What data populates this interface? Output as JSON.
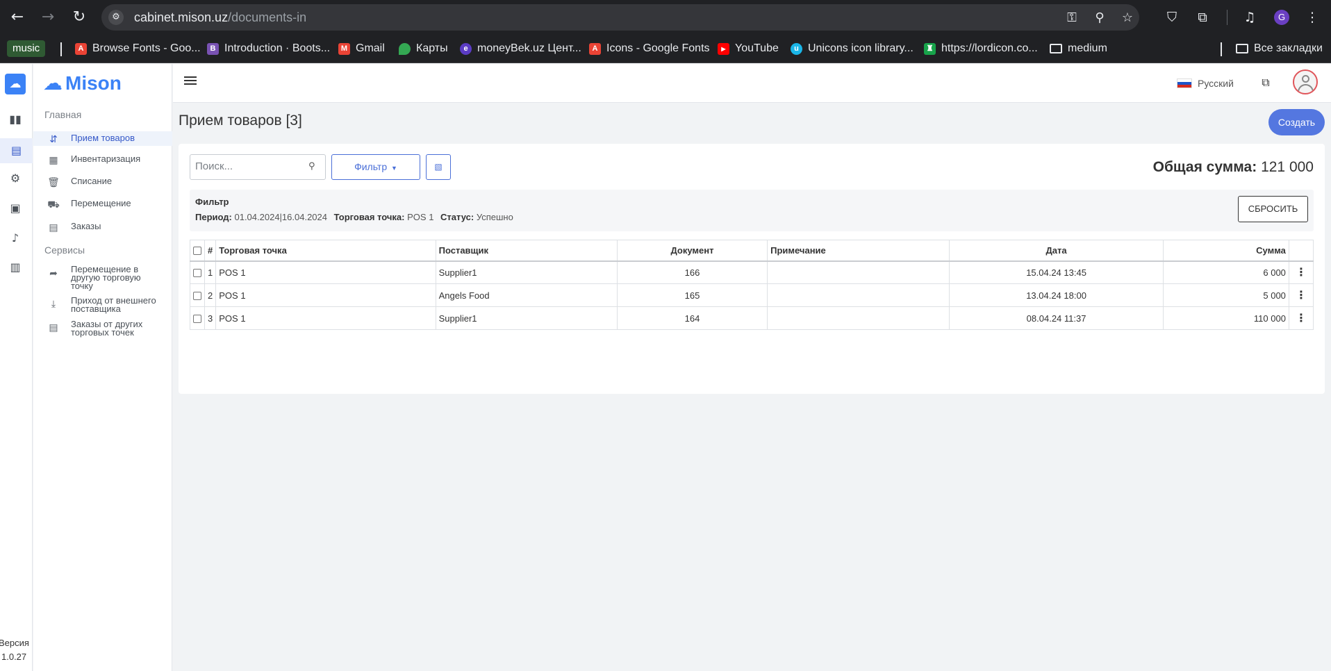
{
  "browser": {
    "url_host": "cabinet.mison.uz",
    "url_path": "/documents-in",
    "profile_initial": "G",
    "icons": [
      "back-arrow-icon",
      "forward-arrow-icon",
      "reload-icon",
      "site-info-icon",
      "password-key-icon",
      "zoom-icon",
      "star-icon",
      "shield-extension-icon",
      "puzzle-icon",
      "media-icon",
      "menu-dots-icon"
    ]
  },
  "bookmarks": {
    "music": "music",
    "items": [
      {
        "label": "Browse Fonts - Goo...",
        "color": "#ea4335"
      },
      {
        "label": "Introduction · Boots...",
        "color": "#7952b3"
      },
      {
        "label": "Gmail",
        "color": "#ea4335"
      },
      {
        "label": "Карты",
        "color": "#34a853"
      },
      {
        "label": "moneyBek.uz Цент...",
        "color": "#5b3cc4"
      },
      {
        "label": "Icons - Google Fonts",
        "color": "#ea4335"
      },
      {
        "label": "YouTube",
        "color": "#ff0000"
      },
      {
        "label": "Unicons icon library...",
        "color": "#1ab6e8"
      },
      {
        "label": "https://lordicon.co...",
        "color": "#17a34a"
      },
      {
        "label": "medium",
        "color": "folder"
      }
    ],
    "all_bookmarks": "Все закладки"
  },
  "app": {
    "brand": "Mison",
    "version_label": "Версия",
    "version_number": "1.0.27",
    "language": "Русский",
    "sidebar": {
      "main_section": "Главная",
      "main_items": [
        {
          "label": "Прием товаров",
          "icon": "receipt-icon",
          "active": true
        },
        {
          "label": "Инвентаризация",
          "icon": "grid-icon",
          "active": false
        },
        {
          "label": "Списание",
          "icon": "trash-icon",
          "active": false
        },
        {
          "label": "Перемещение",
          "icon": "truck-icon",
          "active": false
        },
        {
          "label": "Заказы",
          "icon": "clipboard-icon",
          "active": false
        }
      ],
      "services_section": "Сервисы",
      "service_items": [
        {
          "label": "Перемещение в другую торговую точку",
          "icon": "share-arrow-icon"
        },
        {
          "label": "Приход от внешнего поставщика",
          "icon": "download-icon"
        },
        {
          "label": "Заказы от других торговых точек",
          "icon": "clipboard-icon"
        }
      ]
    },
    "page": {
      "title": "Прием товаров [3]",
      "create_button": "Создать",
      "search_placeholder": "Поиск...",
      "filter_button": "Фильтр",
      "total_label": "Общая сумма:",
      "total_value": "121 000",
      "filter_panel": {
        "title": "Фильтр",
        "period_label": "Период:",
        "period_value": "01.04.2024|16.04.2024",
        "pos_label": "Торговая точка:",
        "pos_value": "POS 1",
        "status_label": "Статус:",
        "status_value": "Успешно",
        "reset_button": "СБРОСИТЬ"
      },
      "table": {
        "headers": {
          "num": "#",
          "pos": "Торговая точка",
          "supplier": "Поставщик",
          "document": "Документ",
          "note": "Примечание",
          "date": "Дата",
          "sum": "Сумма"
        },
        "rows": [
          {
            "num": "1",
            "pos": "POS 1",
            "supplier": "Supplier1",
            "document": "166",
            "note": "",
            "date": "15.04.24 13:45",
            "sum": "6 000"
          },
          {
            "num": "2",
            "pos": "POS 1",
            "supplier": "Angels Food",
            "document": "165",
            "note": "",
            "date": "13.04.24 18:00",
            "sum": "5 000"
          },
          {
            "num": "3",
            "pos": "POS 1",
            "supplier": "Supplier1",
            "document": "164",
            "note": "",
            "date": "08.04.24 11:37",
            "sum": "110 000"
          }
        ]
      }
    }
  }
}
